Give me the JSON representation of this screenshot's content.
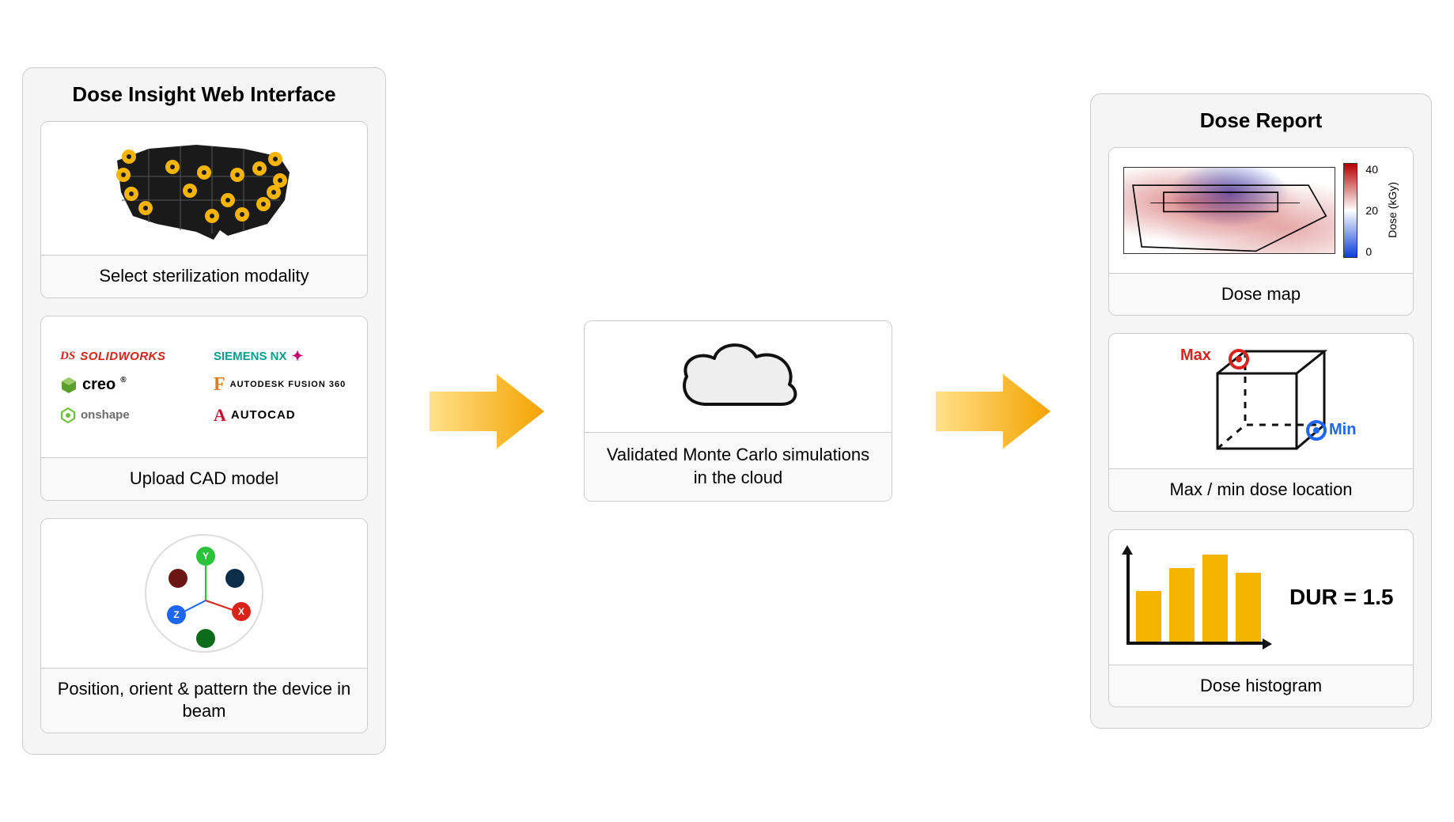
{
  "left": {
    "title": "Dose Insight Web Interface",
    "cards": [
      {
        "caption": "Select sterilization modality"
      },
      {
        "caption": "Upload CAD model",
        "logos": [
          {
            "name": "SOLIDWORKS",
            "color": "#d9231a",
            "prefix": "DS"
          },
          {
            "name": "SIEMENS NX",
            "color": "#009e8e",
            "accent": "#c8006e"
          },
          {
            "name": "creo",
            "color": "#222",
            "icon": "cube-green"
          },
          {
            "name": "AUTODESK FUSION 360",
            "color": "#222",
            "prefix": "F",
            "prefixColor": "#e07b00"
          },
          {
            "name": "onshape",
            "color": "#555",
            "icon": "hex-green"
          },
          {
            "name": "AUTOCAD",
            "color": "#222",
            "prefix": "A",
            "prefixColor": "#c8102e"
          }
        ]
      },
      {
        "caption": "Position, orient & pattern the device in beam"
      }
    ]
  },
  "center": {
    "caption": "Validated Monte Carlo simulations in the cloud"
  },
  "right": {
    "title": "Dose Report",
    "cards": [
      {
        "caption": "Dose map",
        "colorbar": {
          "label": "Dose (kGy)",
          "ticks": [
            "40",
            "20",
            "0"
          ]
        }
      },
      {
        "caption": "Max / min dose location",
        "maxLabel": "Max",
        "minLabel": "Min"
      },
      {
        "caption": "Dose histogram",
        "dur": "DUR = 1.5"
      }
    ]
  },
  "chart_data": {
    "colorbar": {
      "label": "Dose (kGy)",
      "min": 0,
      "max": 40,
      "ticks": [
        0,
        20,
        40
      ]
    },
    "histogram": {
      "type": "bar",
      "values": [
        55,
        80,
        95,
        75
      ],
      "ylim": [
        0,
        100
      ],
      "note": "schematic bar heights (relative)"
    },
    "dur_value": 1.5,
    "orientation_axes": [
      "X",
      "Y",
      "Z"
    ]
  }
}
